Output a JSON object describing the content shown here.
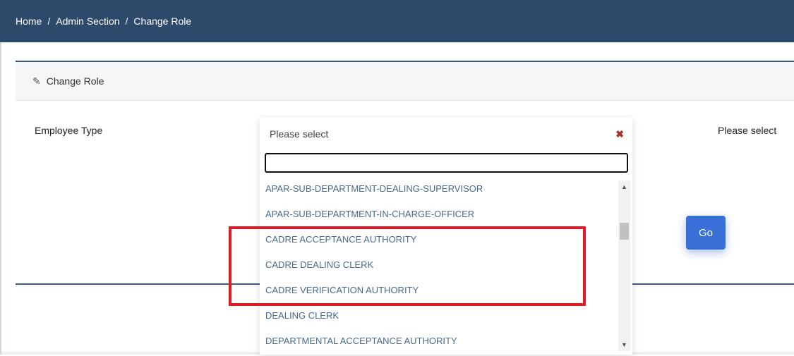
{
  "breadcrumb": {
    "items": [
      "Home",
      "Admin Section",
      "Change Role"
    ],
    "separator": "/"
  },
  "card": {
    "header_icon": "edit-icon",
    "title": "Change Role"
  },
  "form": {
    "employee_type_label": "Employee Type",
    "right_select_placeholder": "Please select",
    "go_label": "Go"
  },
  "dropdown": {
    "selected_text": "Please select",
    "clear_symbol": "✖",
    "search_value": "",
    "options": [
      "APAR-SUB-DEPARTMENT-DEALING-SUPERVISOR",
      "APAR-SUB-DEPARTMENT-IN-CHARGE-OFFICER",
      "CADRE ACCEPTANCE AUTHORITY",
      "CADRE DEALING CLERK",
      "CADRE VERIFICATION AUTHORITY",
      "DEALING CLERK",
      "DEPARTMENTAL ACCEPTANCE AUTHORITY"
    ]
  },
  "colors": {
    "header_bg": "#2e4a6a",
    "go_button": "#3b6fd8",
    "highlight": "#e11a26",
    "option_text": "#4a6a8a"
  }
}
